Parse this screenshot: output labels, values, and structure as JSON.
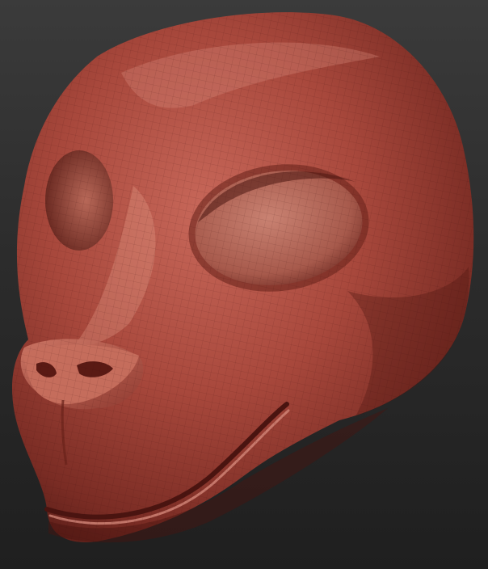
{
  "scene": {
    "subject": "sculpted-creature-head",
    "material_color": "#a8483c",
    "material_shadow": "#5a1e18",
    "material_highlight": "#d98a78",
    "background_top": "#3b3b3b",
    "background_bottom": "#1f1f1f"
  }
}
